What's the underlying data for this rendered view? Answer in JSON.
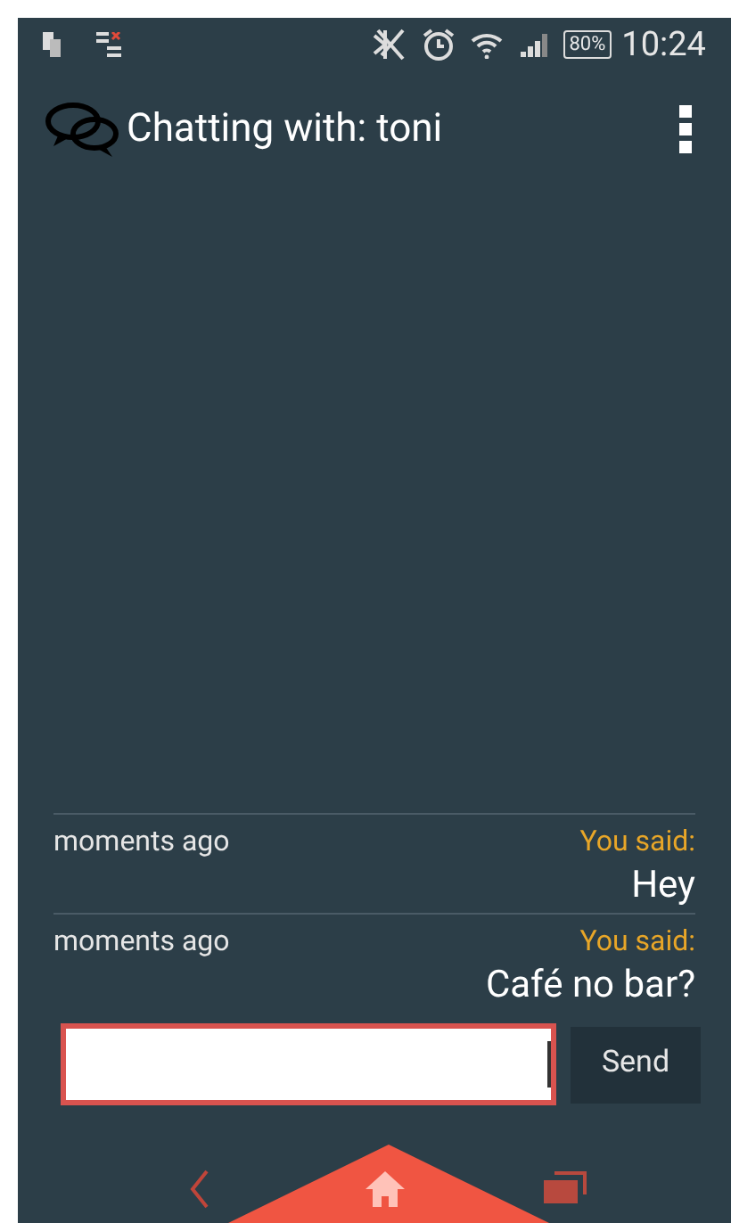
{
  "status_bar": {
    "battery": "80%",
    "time": "10:24"
  },
  "header": {
    "title": "Chatting with: toni"
  },
  "messages": [
    {
      "time": "moments ago",
      "sender": "You said:",
      "text": "Hey"
    },
    {
      "time": "moments ago",
      "sender": "You said:",
      "text": "Café no bar?"
    }
  ],
  "composer": {
    "send_button": "Send"
  }
}
